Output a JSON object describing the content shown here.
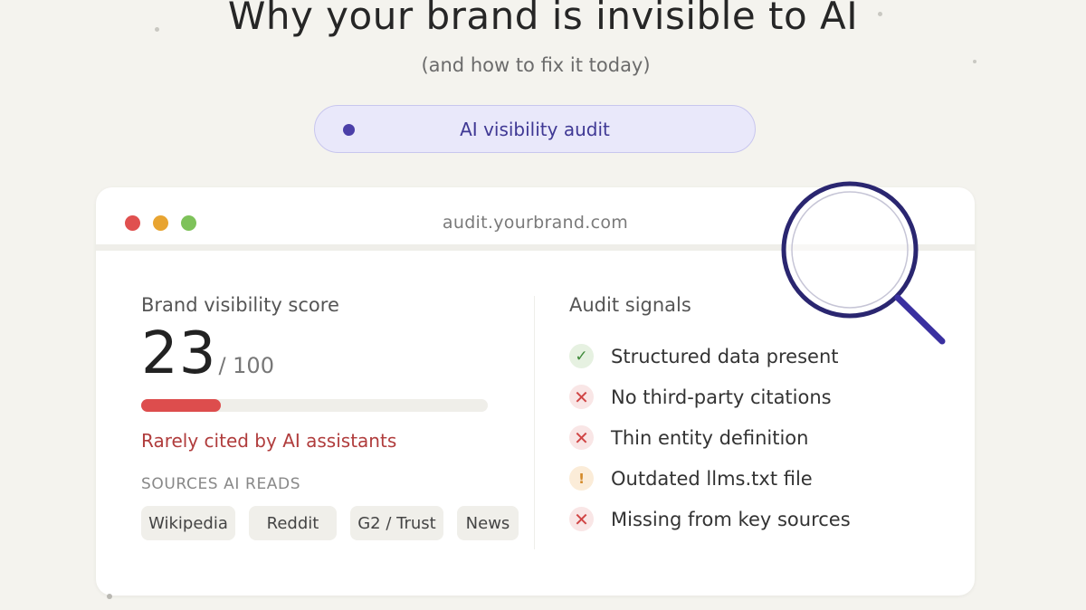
{
  "header": {
    "title": "Why your brand is invisible to AI",
    "subtitle": "(and how to fix it today)"
  },
  "pill": {
    "label": "AI visibility audit",
    "accent": "#4b3fa8"
  },
  "window": {
    "url": "audit.yourbrand.com"
  },
  "score": {
    "label": "Brand visibility score",
    "value": "23",
    "max": "/ 100",
    "fraction": 0.23,
    "rating": "Rarely cited by AI assistants",
    "color": "#dd4d4d"
  },
  "sources": {
    "label": "SOURCES AI READS",
    "items": [
      "Wikipedia",
      "Reddit",
      "G2 / Trust",
      "News"
    ]
  },
  "signals": {
    "label": "Audit signals",
    "items": [
      {
        "text": "Structured data present",
        "status": "ok",
        "icon": "check-icon"
      },
      {
        "text": "No third-party citations",
        "status": "bad",
        "icon": "x-icon"
      },
      {
        "text": "Thin entity definition",
        "status": "bad",
        "icon": "x-icon"
      },
      {
        "text": "Outdated llms.txt file",
        "status": "warn",
        "icon": "exclamation-icon"
      },
      {
        "text": "Missing from key sources",
        "status": "bad",
        "icon": "x-icon"
      }
    ]
  },
  "decor": {
    "magnifier_icon": "magnifier-icon",
    "magnifier_color": "#2a2670"
  }
}
